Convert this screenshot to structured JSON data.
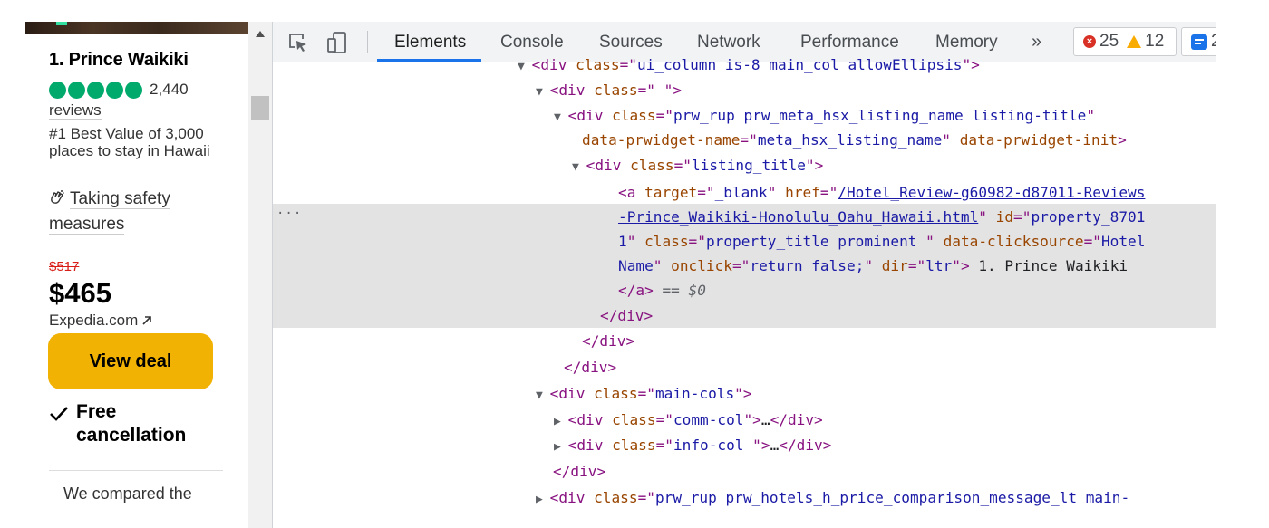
{
  "page": {
    "hotel_title": "1. Prince Waikiki",
    "review_count": "2,440",
    "reviews_word": "reviews",
    "best_value": "#1 Best Value of 3,000 places to stay in Hawaii",
    "safety": "Taking safety measures",
    "old_price": "$517",
    "new_price": "$465",
    "provider": "Expedia.com",
    "deal_button": "View deal",
    "free_cancellation": "Free cancellation",
    "compared": "We compared the"
  },
  "devtools": {
    "tabs": [
      "Elements",
      "Console",
      "Sources",
      "Network",
      "Performance",
      "Memory"
    ],
    "active_tab": "Elements",
    "more_tabs": "»",
    "errors": "25",
    "warnings": "12",
    "messages": "2",
    "selected_marker": "== $0",
    "dots": "···"
  },
  "tree": [
    [
      [
        "tg",
        "<div "
      ],
      [
        "at",
        "class"
      ],
      [
        "tg",
        "=\""
      ],
      [
        "av",
        "ui_column is-8 main_col allowEllipsis"
      ],
      [
        "tg",
        "\">"
      ]
    ],
    [
      [
        "tg",
        "<div "
      ],
      [
        "at",
        "class"
      ],
      [
        "tg",
        "=\""
      ],
      [
        "av",
        " "
      ],
      [
        "tg",
        "\">"
      ]
    ],
    [
      [
        "tg",
        "<div "
      ],
      [
        "at",
        "class"
      ],
      [
        "tg",
        "=\""
      ],
      [
        "av",
        "prw_rup prw_meta_hsx_listing_name listing-title"
      ],
      [
        "tg",
        "\""
      ]
    ],
    [
      [
        "at",
        "data-prwidget-name"
      ],
      [
        "tg",
        "=\""
      ],
      [
        "av",
        "meta_hsx_listing_name"
      ],
      [
        "tg",
        "\" "
      ],
      [
        "at",
        "data-prwidget-init"
      ],
      [
        "tg",
        ">"
      ]
    ],
    [
      [
        "tg",
        "<div "
      ],
      [
        "at",
        "class"
      ],
      [
        "tg",
        "=\""
      ],
      [
        "av",
        "listing_title"
      ],
      [
        "tg",
        "\">"
      ]
    ],
    [
      [
        "tg",
        "<a "
      ],
      [
        "at",
        "target"
      ],
      [
        "tg",
        "=\""
      ],
      [
        "av",
        "_blank"
      ],
      [
        "tg",
        "\" "
      ],
      [
        "at",
        "href"
      ],
      [
        "tg",
        "=\""
      ],
      [
        "lk",
        "/Hotel_Review-g60982-d87011-Reviews"
      ]
    ],
    [
      [
        "lk",
        "-Prince_Waikiki-Honolulu_Oahu_Hawaii.html"
      ],
      [
        "tg",
        "\" "
      ],
      [
        "at",
        "id"
      ],
      [
        "tg",
        "=\""
      ],
      [
        "av",
        "property_8701"
      ]
    ],
    [
      [
        "av",
        "1"
      ],
      [
        "tg",
        "\" "
      ],
      [
        "at",
        "class"
      ],
      [
        "tg",
        "=\""
      ],
      [
        "av",
        "property_title prominent "
      ],
      [
        "tg",
        "\" "
      ],
      [
        "at",
        "data-clicksource"
      ],
      [
        "tg",
        "=\""
      ],
      [
        "av",
        "Hotel"
      ]
    ],
    [
      [
        "av",
        "Name"
      ],
      [
        "tg",
        "\" "
      ],
      [
        "at",
        "onclick"
      ],
      [
        "tg",
        "=\""
      ],
      [
        "av",
        "return false;"
      ],
      [
        "tg",
        "\" "
      ],
      [
        "at",
        "dir"
      ],
      [
        "tg",
        "=\""
      ],
      [
        "av",
        "ltr"
      ],
      [
        "tg",
        "\">"
      ],
      [
        "tx",
        " 1. Prince Waikiki"
      ]
    ],
    [
      [
        "tg",
        "</a>"
      ]
    ],
    [
      [
        "tg",
        "</div>"
      ]
    ],
    [
      [
        "tg",
        "</div>"
      ]
    ],
    [
      [
        "tg",
        "</div>"
      ]
    ],
    [
      [
        "tg",
        "<div "
      ],
      [
        "at",
        "class"
      ],
      [
        "tg",
        "=\""
      ],
      [
        "av",
        "main-cols"
      ],
      [
        "tg",
        "\">"
      ]
    ],
    [
      [
        "tg",
        "<div "
      ],
      [
        "at",
        "class"
      ],
      [
        "tg",
        "=\""
      ],
      [
        "av",
        "comm-col"
      ],
      [
        "tg",
        "\">"
      ],
      [
        "tx",
        "…"
      ],
      [
        "tg",
        "</div>"
      ]
    ],
    [
      [
        "tg",
        "<div "
      ],
      [
        "at",
        "class"
      ],
      [
        "tg",
        "=\""
      ],
      [
        "av",
        "info-col "
      ],
      [
        "tg",
        "\">"
      ],
      [
        "tx",
        "…"
      ],
      [
        "tg",
        "</div>"
      ]
    ],
    [
      [
        "tg",
        "</div>"
      ]
    ],
    [
      [
        "tg",
        "<div "
      ],
      [
        "at",
        "class"
      ],
      [
        "tg",
        "=\""
      ],
      [
        "av",
        "prw_rup prw_hotels_h_price_comparison_message_lt main-"
      ]
    ]
  ],
  "tree_arrows": [
    "▼",
    "▼",
    "▼",
    "",
    "▼",
    "",
    "",
    "",
    "",
    "",
    "",
    "",
    "",
    "▼",
    "▶",
    "▶",
    "",
    "▶"
  ]
}
